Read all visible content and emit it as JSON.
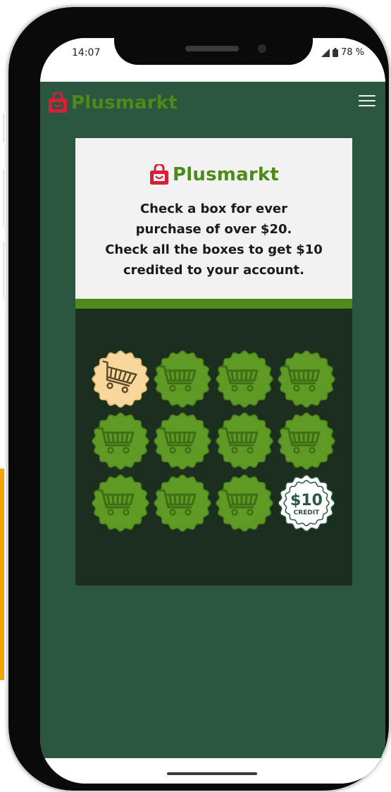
{
  "status_bar": {
    "time": "14:07",
    "battery": "78 %"
  },
  "header": {
    "brand": "Plusmarkt",
    "menu_icon": "hamburger-menu-icon"
  },
  "card": {
    "brand": "Plusmarkt",
    "lines": [
      "Check a box for ever",
      "purchase of over $20.",
      "Check all the boxes to get $10",
      "credited to your account."
    ]
  },
  "punch_card": {
    "total_boxes": 12,
    "checked_boxes": 1,
    "reward_amount": "$10",
    "reward_label": "CREDIT"
  },
  "colors": {
    "app_background": "#2b5640",
    "brand_green": "#4e8a1a",
    "brand_red": "#d81f36",
    "badge_checked": "#f7d79b",
    "badge_unchecked": "#5f9a25",
    "card_dark": "#1c2e1e"
  }
}
